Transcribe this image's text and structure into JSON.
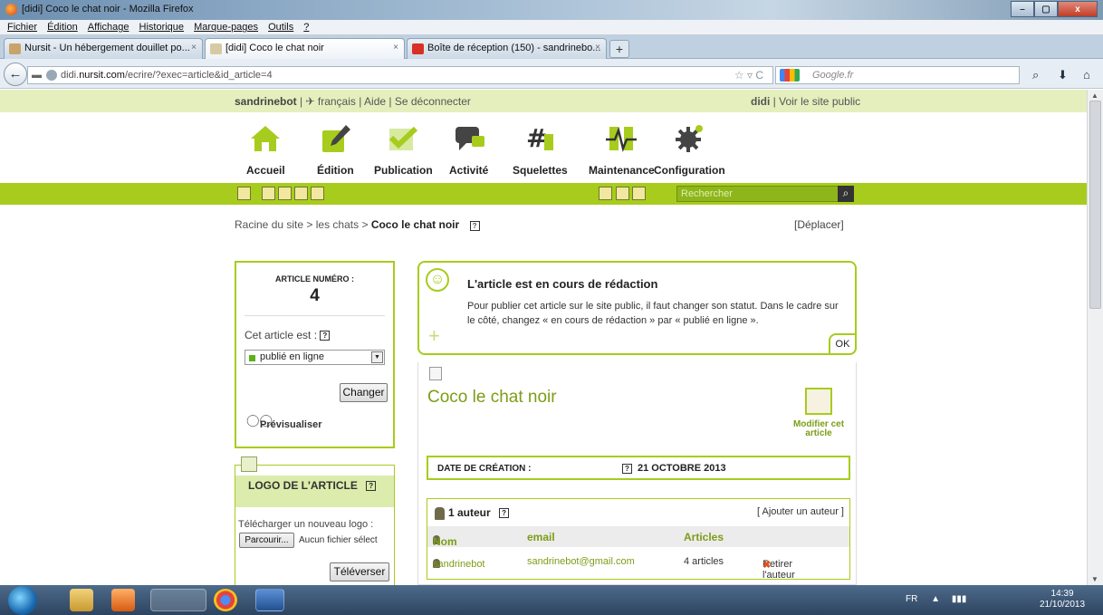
{
  "window": {
    "title": "[didi] Coco le chat noir - Mozilla Firefox",
    "controls": {
      "minimize": "–",
      "maximize": "▢",
      "close": "x"
    }
  },
  "menu": [
    "Fichier",
    "Édition",
    "Affichage",
    "Historique",
    "Marque-pages",
    "Outils",
    "?"
  ],
  "tabs": [
    {
      "label": "Nursit - Un hébergement douillet po...",
      "close": "×"
    },
    {
      "label": "[didi] Coco le chat noir",
      "close": "×"
    },
    {
      "label": "Boîte de réception (150) - sandrinebo...",
      "close": "×"
    }
  ],
  "new_tab": "+",
  "navbar": {
    "back": "←",
    "url_prefix": "didi.",
    "url_host": "nursit.com",
    "url_path": "/ecrire/?exec=article&id_article=4",
    "search_placeholder": "Google.fr",
    "url_icons": "☆ ▿ C"
  },
  "spip": {
    "user": "sandrinebot",
    "lang": "français",
    "aide": "Aide",
    "logout": "Se déconnecter",
    "site": "didi",
    "public": "Voir le site public",
    "nav": [
      {
        "label": "Accueil",
        "icon": "house-icon"
      },
      {
        "label": "Édition",
        "icon": "pencil-icon"
      },
      {
        "label": "Publication",
        "icon": "checkmark-icon"
      },
      {
        "label": "Activité",
        "icon": "speech-bubble-icon"
      },
      {
        "label": "Squelettes",
        "icon": "hash-icon"
      },
      {
        "label": "Maintenance",
        "icon": "pulse-icon"
      },
      {
        "label": "Configuration",
        "icon": "gear-icon"
      }
    ],
    "search_placeholder": "Rechercher",
    "search_icon": "magnifier-icon"
  },
  "breadcrumb": {
    "root": "Racine du site",
    "sep": ">",
    "rubrique": "les chats",
    "current": "Coco le chat noir",
    "help": "?"
  },
  "deplacer": "[Déplacer]",
  "article_box": {
    "label": "ARTICLE NUMÉRO :",
    "number": "4",
    "status_label": "Cet article est :",
    "status_value": "publié en ligne",
    "change_button": "Changer",
    "preview": "Prévisualiser"
  },
  "logo_box": {
    "title": "LOGO DE L'ARTICLE",
    "upload_label": "Télécharger un nouveau logo :",
    "browse_button": "Parcourir...",
    "no_file": "Aucun fichier sélect",
    "upload_button": "Téléverser"
  },
  "notice": {
    "title": "L'article est en cours de rédaction",
    "body": "Pour publier cet article sur le site public, il faut changer son statut. Dans le cadre sur le côté, changez « en cours de rédaction » par « publié en ligne ».",
    "ok": "OK"
  },
  "article": {
    "title": "Coco le chat noir",
    "edit_label": "Modifier cet article",
    "date_label": "DATE DE CRÉATION :",
    "date_value": "21 OCTOBRE 2013",
    "authors_title": "1 auteur",
    "add_author": "[ Ajouter un auteur ]",
    "columns": [
      "Nom",
      "email",
      "Articles"
    ],
    "rows": [
      {
        "name": "sandrinebot",
        "email": "sandrinebot@gmail.com",
        "articles": "4 articles",
        "action": "Retirer l'auteur"
      }
    ]
  },
  "taskbar": {
    "lang": "FR",
    "time": "14:39",
    "date": "21/10/2013"
  }
}
